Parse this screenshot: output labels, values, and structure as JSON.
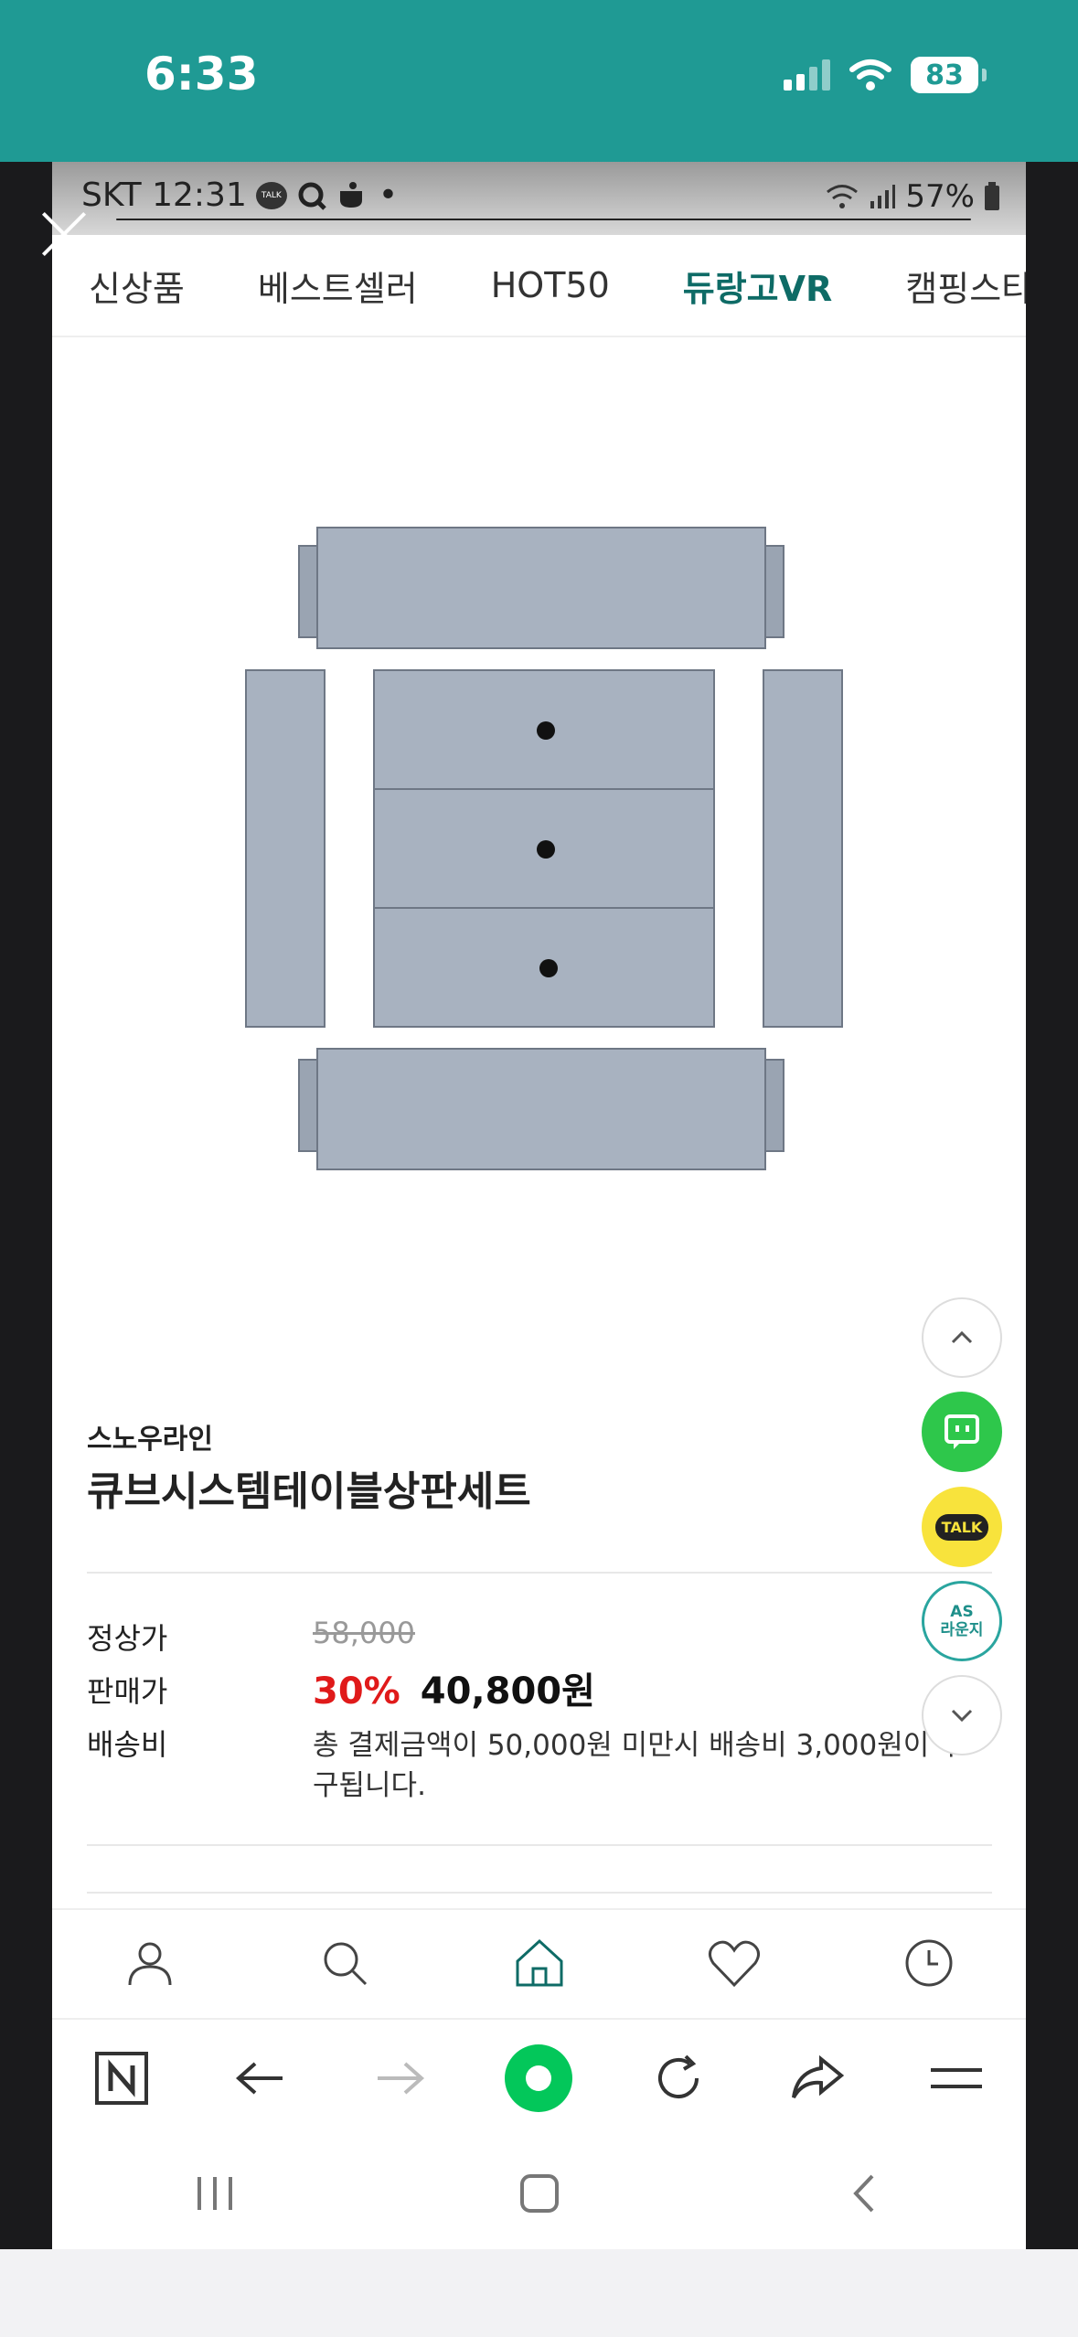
{
  "ios_status": {
    "time": "6:33",
    "battery": "83"
  },
  "android_status": {
    "carrier_time": "SKT 12:31",
    "battery_pct": "57%",
    "talk": "TALK"
  },
  "tabs": [
    {
      "label": "신상품"
    },
    {
      "label": "베스트셀러"
    },
    {
      "label": "HOT50"
    },
    {
      "label": "듀랑고VR"
    },
    {
      "label": "캠핑스타일"
    }
  ],
  "product": {
    "brand": "스노우라인",
    "name": "큐브시스템테이블상판세트",
    "regular_label": "정상가",
    "regular_price": "58,000",
    "sale_label": "판매가",
    "discount": "30%",
    "sale_price": "40,800원",
    "shipping_label": "배송비",
    "shipping_text": "총 결제금액이 50,000원 미만시 배송비 3,000원이 부",
    "shipping_text2": "구됩니다."
  },
  "floating": {
    "talk": "TALK",
    "as_line1": "AS",
    "as_line2": "라운지"
  },
  "colors": {
    "ios_bar": "#1f9a94",
    "accent": "#0e6b66",
    "discount": "#e01a1a",
    "naver_green": "#03c75a"
  },
  "icons": {
    "site_nav": [
      "user-icon",
      "search-icon",
      "home-icon",
      "heart-icon",
      "clock-icon"
    ],
    "browser": [
      "naver-n-icon",
      "back-arrow-icon",
      "forward-arrow-icon",
      "naver-green-dot-icon",
      "refresh-icon",
      "share-icon",
      "menu-icon"
    ],
    "android_nav": [
      "recent-apps-icon",
      "home-square-icon",
      "back-chevron-icon"
    ]
  }
}
